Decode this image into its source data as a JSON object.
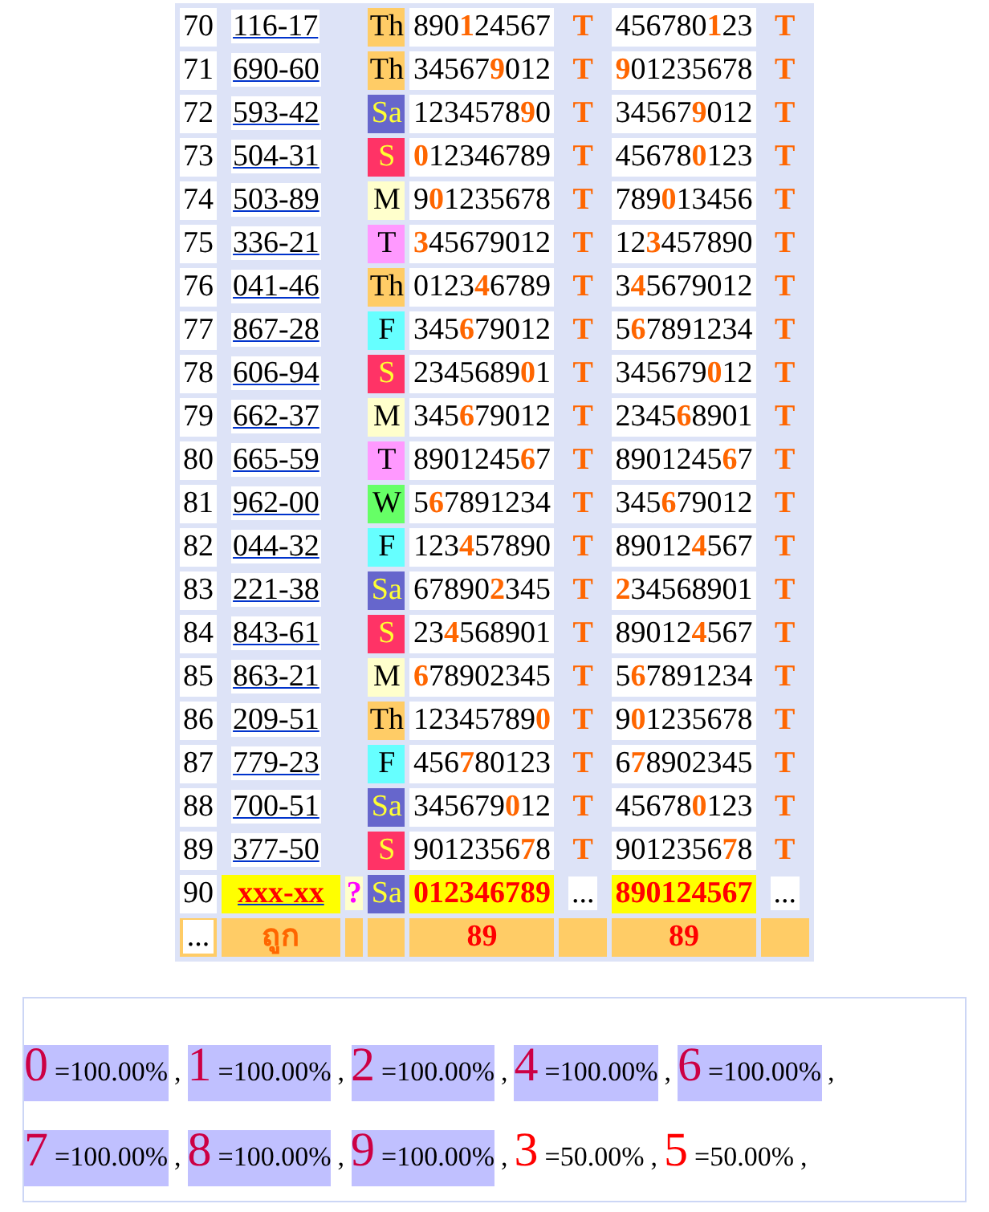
{
  "rows": [
    {
      "kind": "result",
      "number": "70",
      "code": "116-17",
      "day": {
        "label": "Th",
        "color": "#ffcc66"
      },
      "set_1": "890**1**24567",
      "mark_1": "T",
      "set_2": "456780**1**23",
      "mark_2": "T"
    },
    {
      "kind": "result",
      "number": "71",
      "code": "690-60",
      "day": {
        "label": "Th",
        "color": "#ffcc66"
      },
      "set_1": "34567**9**012",
      "mark_1": "T",
      "set_2": "**9**01235678",
      "mark_2": "T"
    },
    {
      "kind": "result",
      "number": "72",
      "code": "593-42",
      "day": {
        "label": "Sa",
        "color": "#6666cc"
      },
      "set_1": "1234578**9**0",
      "mark_1": "T",
      "set_2": "34567**9**012",
      "mark_2": "T"
    },
    {
      "kind": "result",
      "number": "73",
      "code": "504-31",
      "day": {
        "label": "S",
        "color": "#ff3366"
      },
      "set_1": "**0**12346789",
      "mark_1": "T",
      "set_2": "45678**0**123",
      "mark_2": "T"
    },
    {
      "kind": "result",
      "number": "74",
      "code": "503-89",
      "day": {
        "label": "M",
        "color": "#ffffcc"
      },
      "set_1": "9**0**1235678",
      "mark_1": "T",
      "set_2": "789**0**13456",
      "mark_2": "T"
    },
    {
      "kind": "result",
      "number": "75",
      "code": "336-21",
      "day": {
        "label": "T",
        "color": "#ff99ff"
      },
      "set_1": "**3**45679012",
      "mark_1": "T",
      "set_2": "12**3**457890",
      "mark_2": "T"
    },
    {
      "kind": "result",
      "number": "76",
      "code": "041-46",
      "day": {
        "label": "Th",
        "color": "#ffcc66"
      },
      "set_1": "0123**4**6789",
      "mark_1": "T",
      "set_2": "3**4**5679012",
      "mark_2": "T"
    },
    {
      "kind": "result",
      "number": "77",
      "code": "867-28",
      "day": {
        "label": "F",
        "color": "#66ffff"
      },
      "set_1": "345**6**79012",
      "mark_1": "T",
      "set_2": "5**6**7891234",
      "mark_2": "T"
    },
    {
      "kind": "result",
      "number": "78",
      "code": "606-94",
      "day": {
        "label": "S",
        "color": "#ff3366"
      },
      "set_1": "2345689**0**1",
      "mark_1": "T",
      "set_2": "345679**0**12",
      "mark_2": "T"
    },
    {
      "kind": "result",
      "number": "79",
      "code": "662-37",
      "day": {
        "label": "M",
        "color": "#ffffcc"
      },
      "set_1": "345**6**79012",
      "mark_1": "T",
      "set_2": "2345**6**8901",
      "mark_2": "T"
    },
    {
      "kind": "result",
      "number": "80",
      "code": "665-59",
      "day": {
        "label": "T",
        "color": "#ff99ff"
      },
      "set_1": "8901245**6**7",
      "mark_1": "T",
      "set_2": "8901245**6**7",
      "mark_2": "T"
    },
    {
      "kind": "result",
      "number": "81",
      "code": "962-00",
      "day": {
        "label": "W",
        "color": "#66ff66"
      },
      "set_1": "5**6**7891234",
      "mark_1": "T",
      "set_2": "345**6**79012",
      "mark_2": "T"
    },
    {
      "kind": "result",
      "number": "82",
      "code": "044-32",
      "day": {
        "label": "F",
        "color": "#66ffff"
      },
      "set_1": "123**4**57890",
      "mark_1": "T",
      "set_2": "89012**4**567",
      "mark_2": "T"
    },
    {
      "kind": "result",
      "number": "83",
      "code": "221-38",
      "day": {
        "label": "Sa",
        "color": "#6666cc"
      },
      "set_1": "67890**2**345",
      "mark_1": "T",
      "set_2": "**2**34568901",
      "mark_2": "T"
    },
    {
      "kind": "result",
      "number": "84",
      "code": "843-61",
      "day": {
        "label": "S",
        "color": "#ff3366"
      },
      "set_1": "23**4**568901",
      "mark_1": "T",
      "set_2": "89012**4**567",
      "mark_2": "T"
    },
    {
      "kind": "result",
      "number": "85",
      "code": "863-21",
      "day": {
        "label": "M",
        "color": "#ffffcc"
      },
      "set_1": "**6**78902345",
      "mark_1": "T",
      "set_2": "5**6**7891234",
      "mark_2": "T"
    },
    {
      "kind": "result",
      "number": "86",
      "code": "209-51",
      "day": {
        "label": "Th",
        "color": "#ffcc66"
      },
      "set_1": "12345789**0**",
      "mark_1": "T",
      "set_2": "9**0**1235678",
      "mark_2": "T"
    },
    {
      "kind": "result",
      "number": "87",
      "code": "779-23",
      "day": {
        "label": "F",
        "color": "#66ffff"
      },
      "set_1": "456**7**80123",
      "mark_1": "T",
      "set_2": "6**7**8902345",
      "mark_2": "T"
    },
    {
      "kind": "result",
      "number": "88",
      "code": "700-51",
      "day": {
        "label": "Sa",
        "color": "#6666cc"
      },
      "set_1": "345679**0**12",
      "mark_1": "T",
      "set_2": "45678**0**123",
      "mark_2": "T"
    },
    {
      "kind": "result",
      "number": "89",
      "code": "377-50",
      "day": {
        "label": "S",
        "color": "#ff3366"
      },
      "set_1": "9012356**7**8",
      "mark_1": "T",
      "set_2": "9012356**7**8",
      "mark_2": "T"
    },
    {
      "kind": "pending",
      "number": "90",
      "code": "xxx-xx",
      "query": "?",
      "day": {
        "label": "Sa",
        "color": "#6666cc"
      },
      "set_1": "012346789",
      "mark_1": "...",
      "set_2": "890124567",
      "mark_2": "..."
    }
  ],
  "footer": {
    "cell_1": "...",
    "label": "ถูก",
    "count_1": "89",
    "count_2": "89"
  },
  "stats": [
    {
      "digit": "0",
      "percent": "=100.00%",
      "highlighted": true
    },
    {
      "digit": "1",
      "percent": "=100.00%",
      "highlighted": true
    },
    {
      "digit": "2",
      "percent": "=100.00%",
      "highlighted": true
    },
    {
      "digit": "4",
      "percent": "=100.00%",
      "highlighted": true
    },
    {
      "digit": "6",
      "percent": "=100.00%",
      "highlighted": true
    },
    {
      "digit": "7",
      "percent": "=100.00%",
      "highlighted": true
    },
    {
      "digit": "8",
      "percent": "=100.00%",
      "highlighted": true
    },
    {
      "digit": "9",
      "percent": "=100.00%",
      "highlighted": true
    },
    {
      "digit": "3",
      "percent": "=50.00%",
      "highlighted": false
    },
    {
      "digit": "5",
      "percent": "=50.00%",
      "highlighted": false
    }
  ],
  "separator": ","
}
